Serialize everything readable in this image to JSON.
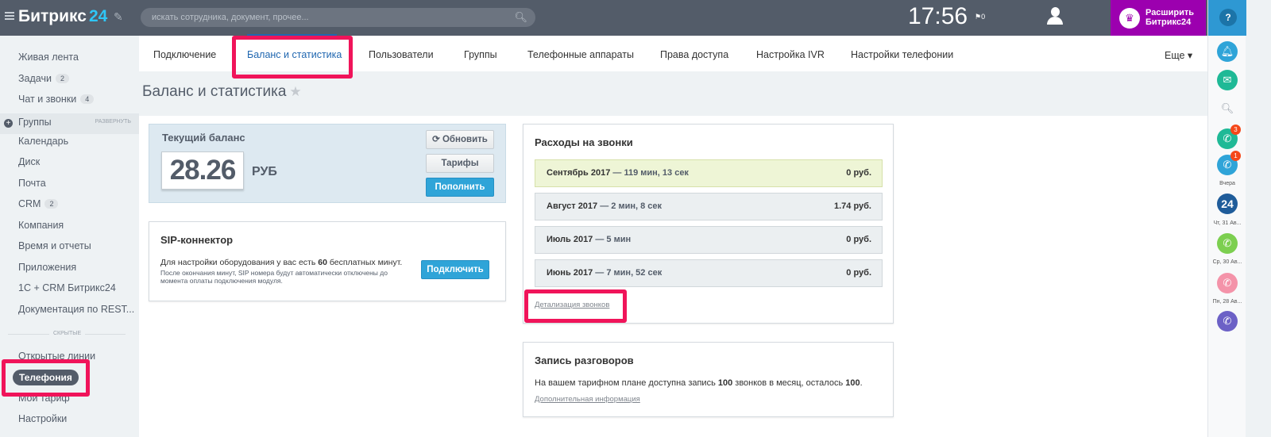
{
  "header": {
    "logo": "Битрикс",
    "logo_num": "24",
    "search_placeholder": "искать сотрудника, документ, прочее...",
    "clock": "17:56",
    "flag_count": "0",
    "upgrade_line1": "Расширить",
    "upgrade_line2": "Битрикс24"
  },
  "sidebar": {
    "items": [
      {
        "label": "Живая лента"
      },
      {
        "label": "Задачи",
        "count": "2"
      },
      {
        "label": "Чат и звонки",
        "count": "4"
      },
      {
        "label": "Группы",
        "action": "РАЗВЕРНУТЬ"
      },
      {
        "label": "Календарь"
      },
      {
        "label": "Диск"
      },
      {
        "label": "Почта"
      },
      {
        "label": "CRM",
        "count": "2"
      },
      {
        "label": "Компания"
      },
      {
        "label": "Время и отчеты"
      },
      {
        "label": "Приложения"
      },
      {
        "label": "1С + CRM Битрикс24"
      },
      {
        "label": "Документация по REST..."
      }
    ],
    "hidden_label": "СКРЫТЫЕ",
    "hidden_items": [
      {
        "label": "Открытые линии"
      },
      {
        "label": "Телефония"
      },
      {
        "label": "Мой тариф"
      },
      {
        "label": "Настройки"
      }
    ]
  },
  "tabs": [
    {
      "label": "Подключение"
    },
    {
      "label": "Баланс и статистика",
      "active": true
    },
    {
      "label": "Пользователи"
    },
    {
      "label": "Группы"
    },
    {
      "label": "Телефонные аппараты"
    },
    {
      "label": "Права доступа"
    },
    {
      "label": "Настройка IVR"
    },
    {
      "label": "Настройки телефонии"
    }
  ],
  "more_label": "Еще ▾",
  "page_title": "Баланс и статистика",
  "balance": {
    "title": "Текущий баланс",
    "value": "28.26",
    "currency": "РУБ",
    "refresh_label": "Обновить",
    "tariffs_label": "Тарифы",
    "topup_label": "Пополнить"
  },
  "sip": {
    "title": "SIP-коннектор",
    "desc_pre": "Для настройки оборудования у вас есть ",
    "desc_num": "60",
    "desc_post": " бесплатных минут.",
    "note": "После окончания минут, SIP номера будут автоматически отключены до момента оплаты подключения модуля.",
    "connect_label": "Подключить"
  },
  "costs": {
    "title": "Расходы на звонки",
    "months": [
      {
        "month": "Сентябрь 2017",
        "duration": "— 119 мин, 13 сек",
        "amount": "0 руб."
      },
      {
        "month": "Август 2017",
        "duration": "— 2 мин, 8 сек",
        "amount": "1.74 руб."
      },
      {
        "month": "Июль 2017",
        "duration": "— 5 мин",
        "amount": "0 руб."
      },
      {
        "month": "Июнь 2017",
        "duration": "— 7 мин, 52 сек",
        "amount": "0 руб."
      }
    ],
    "details_link": "Детализация звонков"
  },
  "recording": {
    "title": "Запись разговоров",
    "desc_pre": "На вашем тарифном плане доступна запись ",
    "desc_num1": "100",
    "desc_mid": " звонков в месяц, осталось ",
    "desc_num2": "100",
    "desc_post": ".",
    "more_link": "Дополнительная информация"
  },
  "right_panel": {
    "help": "?",
    "badge1": "3",
    "badge2": "1",
    "label_yesterday": "Вчера",
    "logo24": "24",
    "date1": "Чт, 31 Ав...",
    "date2": "Ср, 30 Ав...",
    "date3": "Пн, 28 Ав..."
  },
  "colors": {
    "topbar": "#535c69",
    "accent": "#2067b0",
    "upgrade": "#9c00af",
    "highlight": "#f0145a",
    "button_blue": "#2fa4d8"
  }
}
